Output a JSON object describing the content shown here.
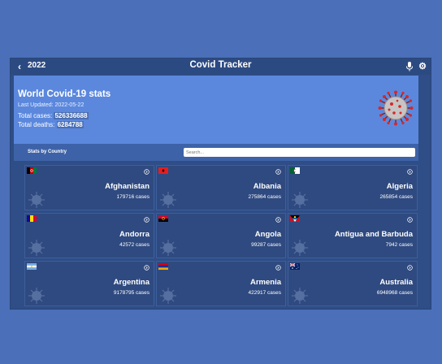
{
  "appbar": {
    "year": "2022",
    "title": "Covid Tracker",
    "back_icon": "chevron-left-icon",
    "mic_icon": "microphone-icon",
    "settings_icon": "gear-icon"
  },
  "world": {
    "title": "World Covid-19 stats",
    "updated": "Last Updated: 2022-05-22",
    "cases_label": "Total cases:",
    "cases_value": "526336688",
    "deaths_label": "Total deaths:",
    "deaths_value": "6284788"
  },
  "filter": {
    "label": "Stats by Country",
    "search_placeholder": "Search..."
  },
  "countries": [
    {
      "name": "Afghanistan",
      "cases": "179716 cases"
    },
    {
      "name": "Albania",
      "cases": "275864 cases"
    },
    {
      "name": "Algeria",
      "cases": "265854 cases"
    },
    {
      "name": "Andorra",
      "cases": "42572 cases"
    },
    {
      "name": "Angola",
      "cases": "99287 cases"
    },
    {
      "name": "Antigua and Barbuda",
      "cases": "7942 cases"
    },
    {
      "name": "Argentina",
      "cases": "9178795 cases"
    },
    {
      "name": "Armenia",
      "cases": "422917 cases"
    },
    {
      "name": "Australia",
      "cases": "6948968 cases"
    }
  ],
  "colors": {
    "background": "#4b6fb8",
    "hero": "#5b88dd",
    "card": "#2f4a80",
    "appbar": "#2c4a82"
  }
}
